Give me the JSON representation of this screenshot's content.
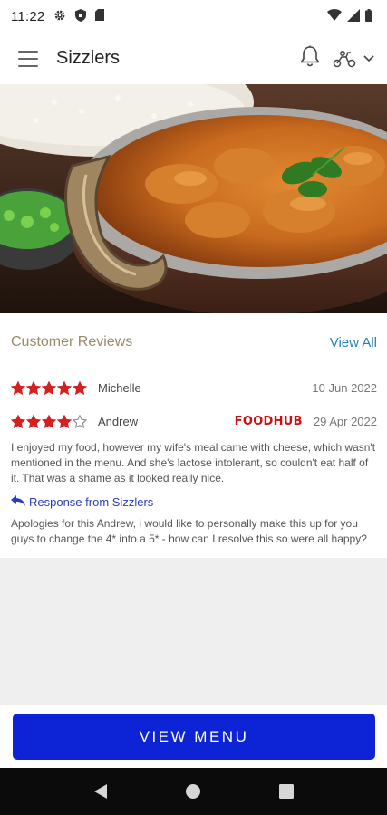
{
  "status_bar": {
    "time": "11:22",
    "icons": [
      "gear-icon",
      "shield-icon",
      "sim-icon",
      "wifi-icon",
      "signal-icon",
      "battery-icon"
    ]
  },
  "app_bar": {
    "title": "Sizzlers",
    "icons": [
      "hamburger-menu-icon",
      "bell-icon",
      "delivery-scooter-icon",
      "chevron-down-icon"
    ]
  },
  "hero": {
    "image": "curry-bowl-photo"
  },
  "reviews": {
    "title": "Customer Reviews",
    "view_all": "View All",
    "items": [
      {
        "name": "Michelle",
        "rating": 5,
        "date": "10 Jun 2022",
        "source": "",
        "text": ""
      },
      {
        "name": "Andrew",
        "rating": 4,
        "date": "29 Apr 2022",
        "source": "FOODHUB",
        "text": "I enjoyed my food, however my wife's meal came with cheese, which wasn't mentioned in the menu. And she's lactose intolerant, so couldn't eat half of it. That was a shame as it looked really nice.",
        "response_label": "Response from Sizzlers",
        "response_text": "Apologies for this Andrew, i would like to personally make this up for you guys to change the 4* into a 5* - how can I resolve this so were all happy?"
      }
    ]
  },
  "cta": {
    "label": "VIEW MENU"
  },
  "colors": {
    "star": "#d42020",
    "brand_button": "#0d24d6",
    "link": "#2a7fb8",
    "response_link": "#2b3dbf",
    "source_badge": "#d01010",
    "section_title": "#9a8a6a"
  }
}
